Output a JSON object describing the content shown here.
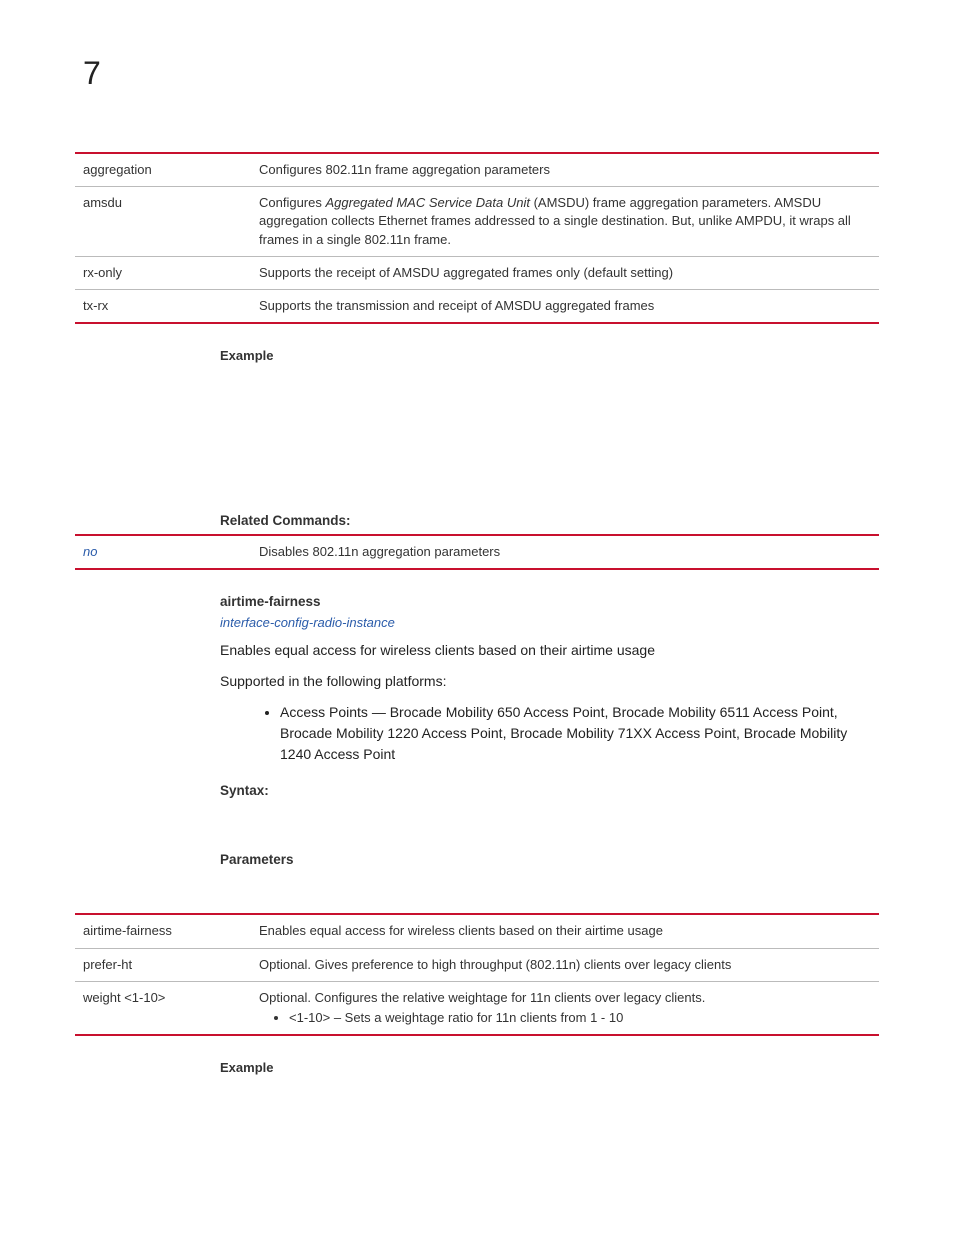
{
  "pageNumber": "7",
  "table1": {
    "rows": [
      {
        "term": "aggregation",
        "desc": "Configures 802.11n frame aggregation parameters"
      },
      {
        "term": "amsdu",
        "desc_pre": "Configures ",
        "desc_ital": "Aggregated MAC Service Data Unit",
        "desc_post": " (AMSDU) frame aggregation parameters. AMSDU aggregation collects Ethernet frames addressed to a single destination. But, unlike AMPDU, it wraps all frames in a single 802.11n frame."
      },
      {
        "term": "rx-only",
        "desc": "Supports the receipt of AMSDU aggregated frames only (default setting)"
      },
      {
        "term": "tx-rx",
        "desc": "Supports the transmission and receipt of AMSDU aggregated frames"
      }
    ]
  },
  "exampleLabel": "Example",
  "relatedCommandsHeading": "Related Commands:",
  "table2": {
    "rows": [
      {
        "term": "no",
        "desc": "Disables 802.11n aggregation parameters"
      }
    ]
  },
  "airtime": {
    "heading": "airtime-fairness",
    "link": "interface-config-radio-instance",
    "desc": "Enables equal access for wireless clients based on their airtime usage",
    "supported": "Supported in the following platforms:",
    "bullet": "Access Points — Brocade Mobility 650 Access Point, Brocade Mobility 6511 Access Point, Brocade Mobility 1220 Access Point, Brocade Mobility 71XX Access Point, Brocade Mobility 1240 Access Point"
  },
  "syntaxLabel": "Syntax:",
  "parametersLabel": "Parameters",
  "table3": {
    "rows": [
      {
        "term": "airtime-fairness",
        "desc": "Enables equal access for wireless clients based on their airtime usage"
      },
      {
        "term": "prefer-ht",
        "desc": "Optional. Gives preference to high throughput (802.11n) clients over legacy clients"
      },
      {
        "term": "weight <1-10>",
        "desc": "Optional. Configures the relative weightage for 11n clients over legacy clients.",
        "sub": "<1-10> – Sets a weightage ratio for 11n clients from 1 - 10"
      }
    ]
  }
}
